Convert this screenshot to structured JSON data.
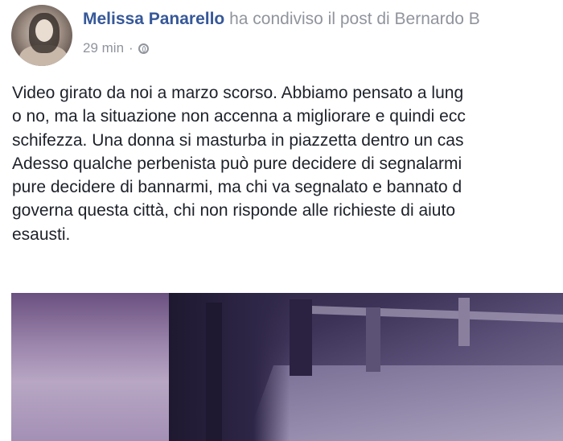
{
  "post": {
    "author": "Melissa Panarello",
    "action_text": " ha condiviso il post di Bernardo B",
    "timestamp": "29 min",
    "separator": "·",
    "privacy_icon": "globe-icon",
    "text_lines": [
      "Video girato da noi a marzo scorso. Abbiamo pensato a lung",
      "o no, ma la situazione non accenna a migliorare e quindi ecc",
      "schifezza. Una donna si masturba in piazzetta dentro un cas",
      "Adesso qualche perbenista può pure decidere di segnalarmi",
      "pure decidere di bannarmi, ma chi va segnalato e bannato d",
      "governa questa città, chi non risponde alle richieste di aiuto",
      "esausti."
    ]
  },
  "colors": {
    "author_link": "#365899",
    "meta_gray": "#90949c",
    "body_text": "#1d2129"
  }
}
